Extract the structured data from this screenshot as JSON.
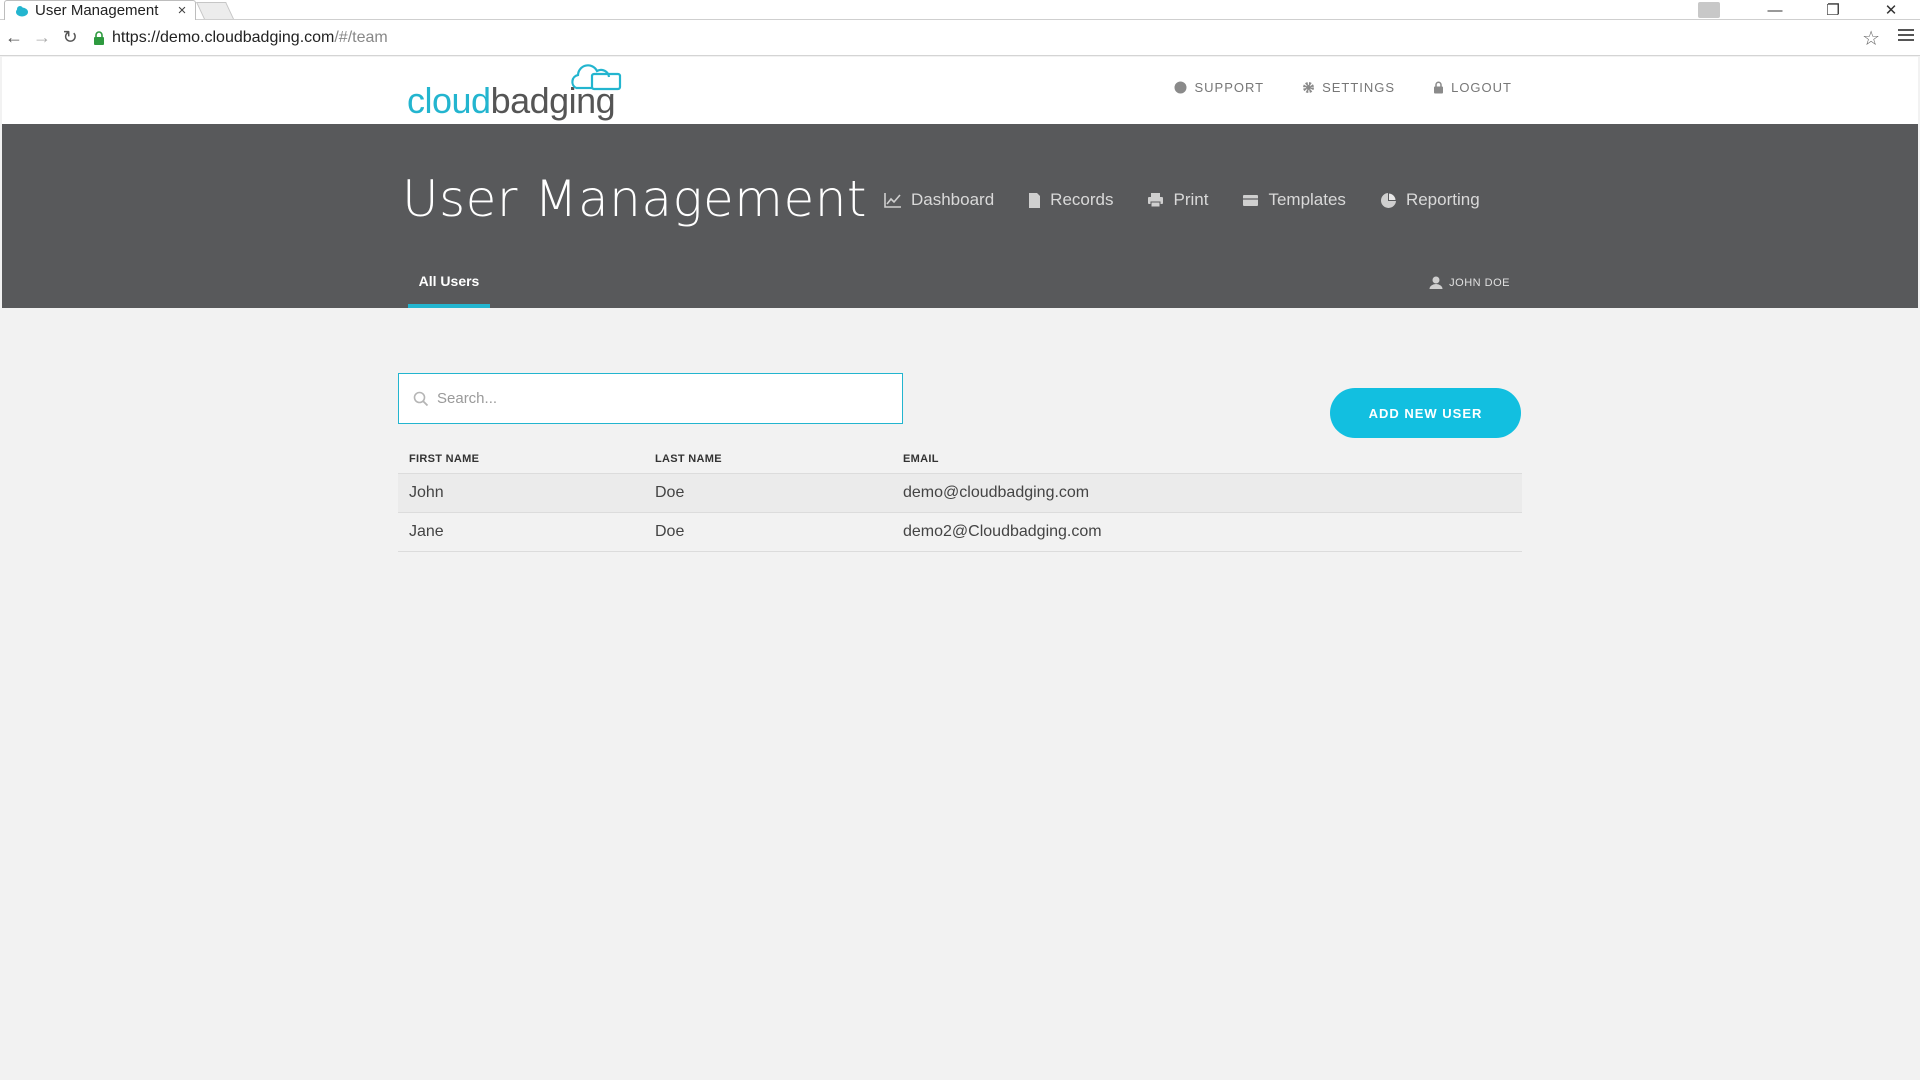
{
  "browser": {
    "tab_title": "User Management",
    "tab_close": "×",
    "url_host": "https://demo.cloudbadging.com",
    "url_path": "/#/team",
    "star": "☆",
    "back": "←",
    "forward": "→",
    "reload": "↻",
    "minimize": "—",
    "restore": "❐",
    "close": "✕"
  },
  "brand": {
    "part1": "cloud",
    "part2": "badging",
    "accent": "#23b5cf"
  },
  "top_nav": {
    "support": "SUPPORT",
    "settings": "SETTINGS",
    "logout": "LOGOUT"
  },
  "page": {
    "title": "User Management"
  },
  "main_nav": {
    "dashboard": "Dashboard",
    "records": "Records",
    "print": "Print",
    "templates": "Templates",
    "reporting": "Reporting"
  },
  "subtabs": {
    "all_users": "All Users"
  },
  "current_user": "JOHN DOE",
  "search": {
    "placeholder": "Search...",
    "value": ""
  },
  "actions": {
    "add_user": "ADD NEW USER"
  },
  "table": {
    "headers": {
      "first_name": "FIRST NAME",
      "last_name": "LAST NAME",
      "email": "EMAIL"
    },
    "rows": [
      {
        "first": "John",
        "last": "Doe",
        "email": "demo@cloudbadging.com"
      },
      {
        "first": "Jane",
        "last": "Doe",
        "email": "demo2@Cloudbadging.com"
      }
    ]
  },
  "icons": {
    "support": "support-icon",
    "settings": "gear-icon",
    "logout": "lock-icon",
    "dashboard": "chart-line-icon",
    "records": "file-icon",
    "print": "printer-icon",
    "templates": "templates-icon",
    "reporting": "pie-chart-icon",
    "user": "user-icon",
    "search": "search-icon"
  }
}
